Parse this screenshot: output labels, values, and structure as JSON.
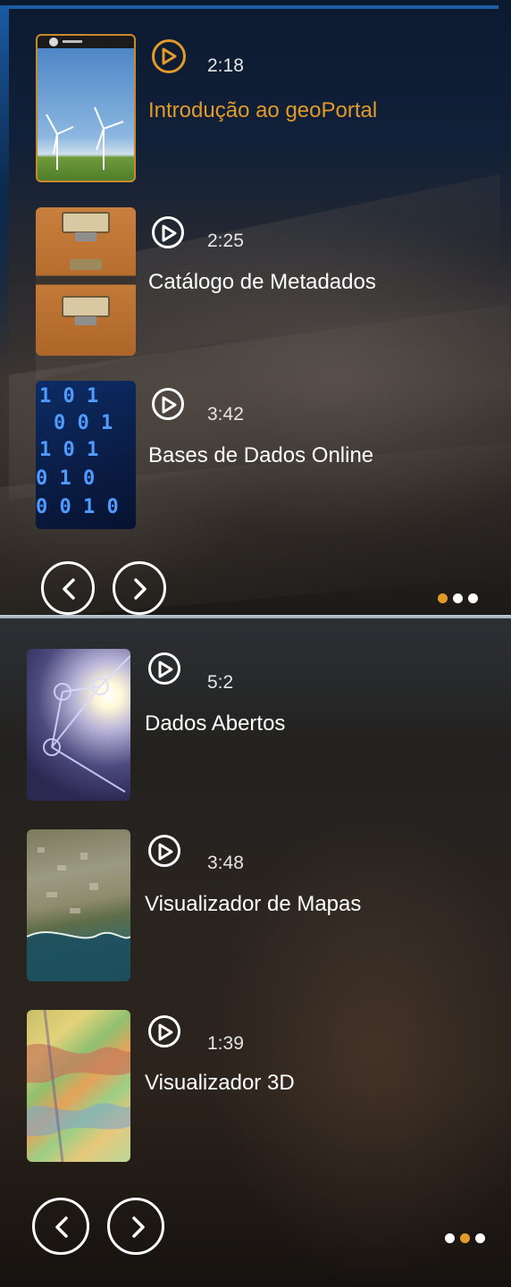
{
  "colors": {
    "accent": "#e39a2a",
    "text": "#ffffff",
    "frame_blue": "#1c5fa8"
  },
  "carousels": [
    {
      "items": [
        {
          "duration": "2:18",
          "title": "Introdução ao geoPortal",
          "thumbnail": "wind-turbines-image",
          "active": true
        },
        {
          "duration": "2:25",
          "title": "Catálogo de Metadados",
          "thumbnail": "card-catalog-drawers-image",
          "active": false
        },
        {
          "duration": "3:42",
          "title": "Bases de Dados Online",
          "thumbnail": "binary-code-image",
          "active": false
        }
      ],
      "prev_icon": "chevron-left-icon",
      "next_icon": "chevron-right-icon",
      "page_count": 3,
      "active_page": 1
    },
    {
      "items": [
        {
          "duration": "5:2",
          "title": "Dados Abertos",
          "thumbnail": "network-light-image",
          "active": false
        },
        {
          "duration": "3:48",
          "title": "Visualizador de Mapas",
          "thumbnail": "satellite-coast-image",
          "active": false
        },
        {
          "duration": "1:39",
          "title": "Visualizador 3D",
          "thumbnail": "geological-map-image",
          "active": false
        }
      ],
      "prev_icon": "chevron-left-icon",
      "next_icon": "chevron-right-icon",
      "page_count": 3,
      "active_page": 2
    }
  ]
}
